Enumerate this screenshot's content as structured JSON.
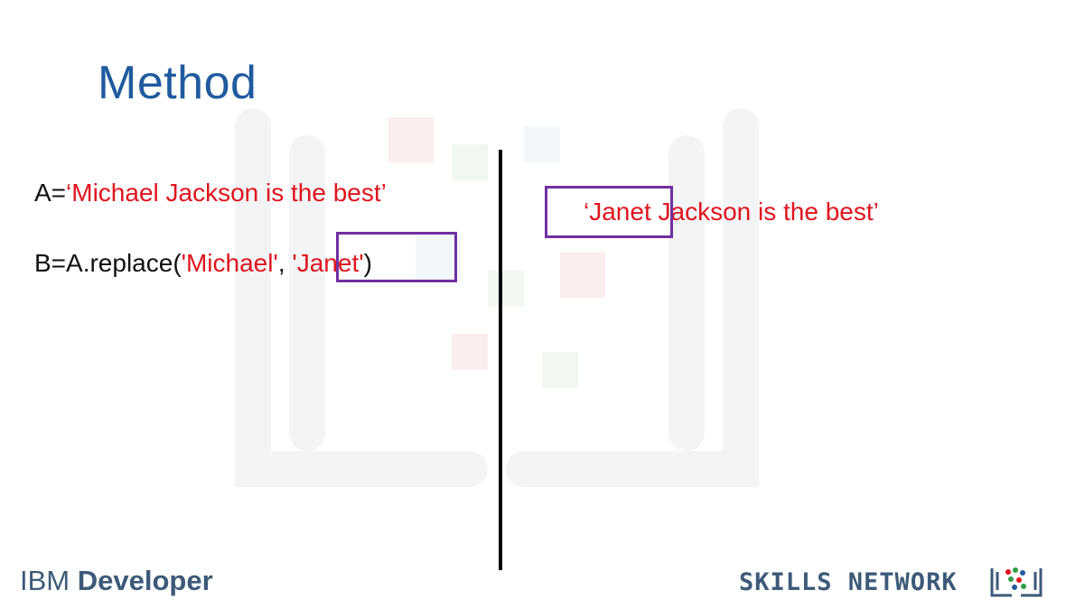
{
  "slide": {
    "title": "Method",
    "code": {
      "line_a": {
        "prefix": "A=",
        "value": "‘Michael Jackson is the best’"
      },
      "line_b": {
        "prefix": "B=A.replace(",
        "arg1": "'Michael'",
        "sep": ", ",
        "arg2": "'Janet'",
        "suffix": ")"
      }
    },
    "result": "‘Janet Jackson is the best’",
    "footer": {
      "ibm_prefix": "IBM ",
      "ibm_bold": "Developer",
      "skills_network": "SKILLS NETWORK"
    },
    "colors": {
      "title": "#1f5b9e",
      "string": "#e0141e",
      "highlight_box": "#7030a0",
      "footer": "#3c5a78"
    }
  }
}
